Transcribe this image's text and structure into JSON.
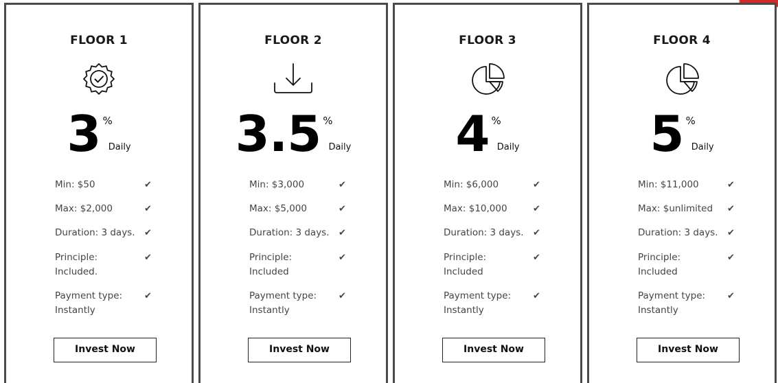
{
  "colors": {
    "border": "#4a4a4a",
    "text": "#1a1a1a",
    "muted": "#444444",
    "corner_accent": "#d42a2a"
  },
  "plans": [
    {
      "title": "FLOOR 1",
      "icon": "badge-check-icon",
      "rate": "3",
      "percent_sign": "%",
      "period": "Daily",
      "features": [
        "Min: $50",
        "Max: $2,000",
        "Duration: 3 days.",
        "Principle: Included.",
        "Payment type: Instantly"
      ],
      "button": "Invest Now"
    },
    {
      "title": "FLOOR 2",
      "icon": "download-icon",
      "rate": "3.5",
      "percent_sign": "%",
      "period": "Daily",
      "features": [
        "Min: $3,000",
        "Max: $5,000",
        "Duration: 3 days.",
        "Principle: Included",
        "Payment type: Instantly"
      ],
      "button": "Invest Now"
    },
    {
      "title": "FLOOR 3",
      "icon": "pie-chart-icon",
      "rate": "4",
      "percent_sign": "%",
      "period": "Daily",
      "features": [
        "Min: $6,000",
        "Max: $10,000",
        "Duration: 3 days.",
        "Principle: Included",
        "Payment type: Instantly"
      ],
      "button": "Invest Now"
    },
    {
      "title": "FLOOR 4",
      "icon": "pie-chart-icon",
      "rate": "5",
      "percent_sign": "%",
      "period": "Daily",
      "features": [
        "Min: $11,000",
        "Max: $unlimited",
        "Duration: 3 days.",
        "Principle: Included",
        "Payment type: Instantly"
      ],
      "button": "Invest Now"
    }
  ],
  "check_glyph": "✔"
}
